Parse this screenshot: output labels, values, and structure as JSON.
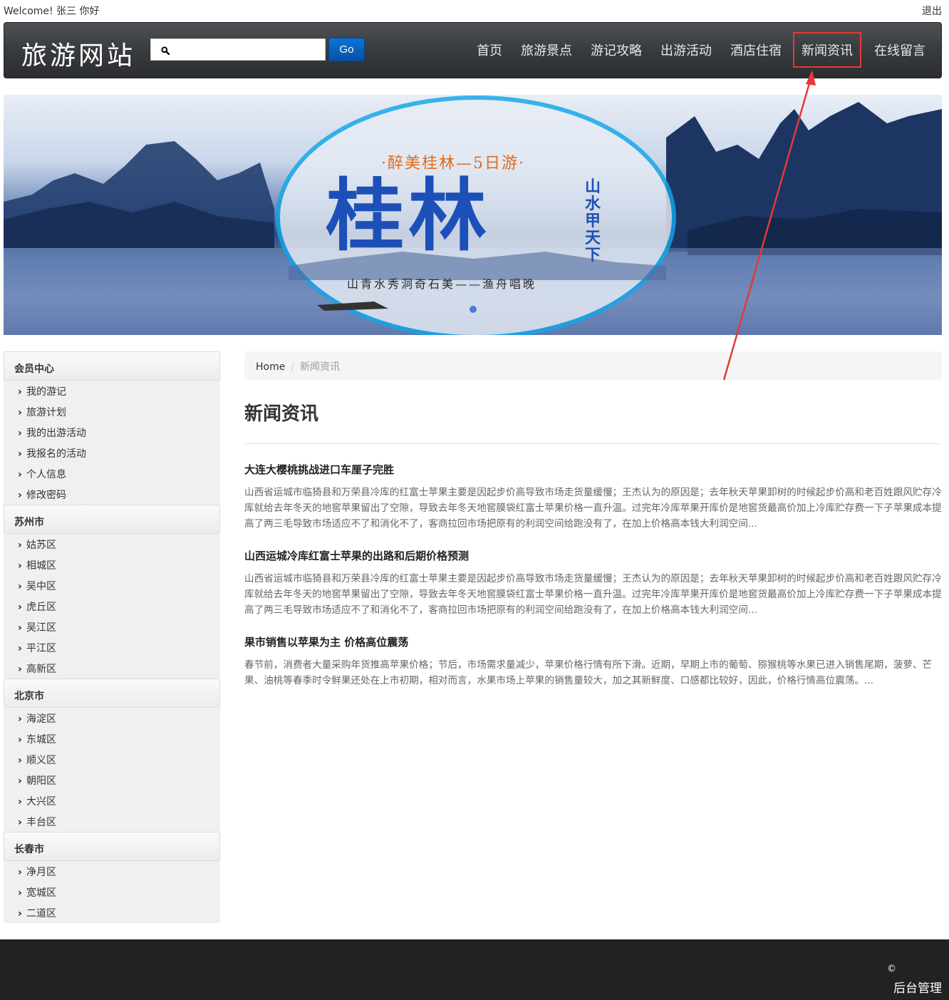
{
  "topbar": {
    "welcome": "Welcome! 张三 你好",
    "logout": "退出"
  },
  "navbar": {
    "brand": "旅游网站",
    "search_placeholder": "",
    "search_button": "Go",
    "items": [
      {
        "label": "首页"
      },
      {
        "label": "旅游景点"
      },
      {
        "label": "游记攻略"
      },
      {
        "label": "出游活动"
      },
      {
        "label": "酒店住宿"
      },
      {
        "label": "新闻资讯"
      },
      {
        "label": "在线留言"
      }
    ]
  },
  "banner": {
    "subtitle": "·醉美桂林—5日游·",
    "title": "桂林",
    "vertical": "山水甲天下",
    "slogan": "山青水秀洞奇石美——渔舟唱晚"
  },
  "sidebar": {
    "groups": [
      {
        "title": "会员中心",
        "items": [
          "我的游记",
          "旅游计划",
          "我的出游活动",
          "我报名的活动",
          "个人信息",
          "修改密码"
        ]
      },
      {
        "title": "苏州市",
        "items": [
          "姑苏区",
          "相城区",
          "吴中区",
          "虎丘区",
          "吴江区",
          "平江区",
          "高新区"
        ]
      },
      {
        "title": "北京市",
        "items": [
          "海淀区",
          "东城区",
          "顺义区",
          "朝阳区",
          "大兴区",
          "丰台区"
        ]
      },
      {
        "title": "长春市",
        "items": [
          "净月区",
          "宽城区",
          "二道区"
        ]
      }
    ]
  },
  "breadcrumb": {
    "home": "Home",
    "separator": "/",
    "current": "新闻资讯"
  },
  "page_title": "新闻资讯",
  "news": [
    {
      "title": "大连大樱桃挑战进口车厘子完胜",
      "body": "山西省运城市临猗县和万荣县冷库的红富士苹果主要是因起步价高导致市场走货量缓慢；王杰认为的原因是；去年秋天苹果卸树的时候起步价高和老百姓跟风贮存冷库就给去年冬天的地窖苹果留出了空隙，导致去年冬天地窖膜袋红富士苹果价格一直升温。过完年冷库苹果开库价是地窖货最高价加上冷库贮存费一下子苹果成本提高了两三毛导致市场适应不了和消化不了，客商拉回市场把原有的利润空间给跑没有了，在加上价格高本钱大利润空间..."
    },
    {
      "title": "山西运城冷库红富士苹果的出路和后期价格预测",
      "body": "山西省运城市临猗县和万荣县冷库的红富士苹果主要是因起步价高导致市场走货量缓慢；王杰认为的原因是；去年秋天苹果卸树的时候起步价高和老百姓跟风贮存冷库就给去年冬天的地窖苹果留出了空隙，导致去年冬天地窖膜袋红富士苹果价格一直升温。过完年冷库苹果开库价是地窖货最高价加上冷库贮存费一下子苹果成本提高了两三毛导致市场适应不了和消化不了，客商拉回市场把原有的利润空间给跑没有了，在加上价格高本钱大利润空间..."
    },
    {
      "title": "果市销售以苹果为主 价格高位震荡",
      "body": "春节前，消费者大量采购年货推高苹果价格；节后，市场需求量减少，苹果价格行情有所下滑。近期，早期上市的葡萄、猕猴桃等水果已进入销售尾期，菠萝、芒果、油桃等春季时令鲜果还处在上市初期，相对而言，水果市场上苹果的销售量较大，加之其新鲜度、口感都比较好，因此，价格行情高位震荡。..."
    }
  ],
  "footer": {
    "copyright": "©",
    "admin": "后台管理"
  },
  "colors": {
    "navbar": "#3a3d40",
    "go_button": "#0a63c4",
    "highlight": "#e53935",
    "footer": "#222222"
  }
}
